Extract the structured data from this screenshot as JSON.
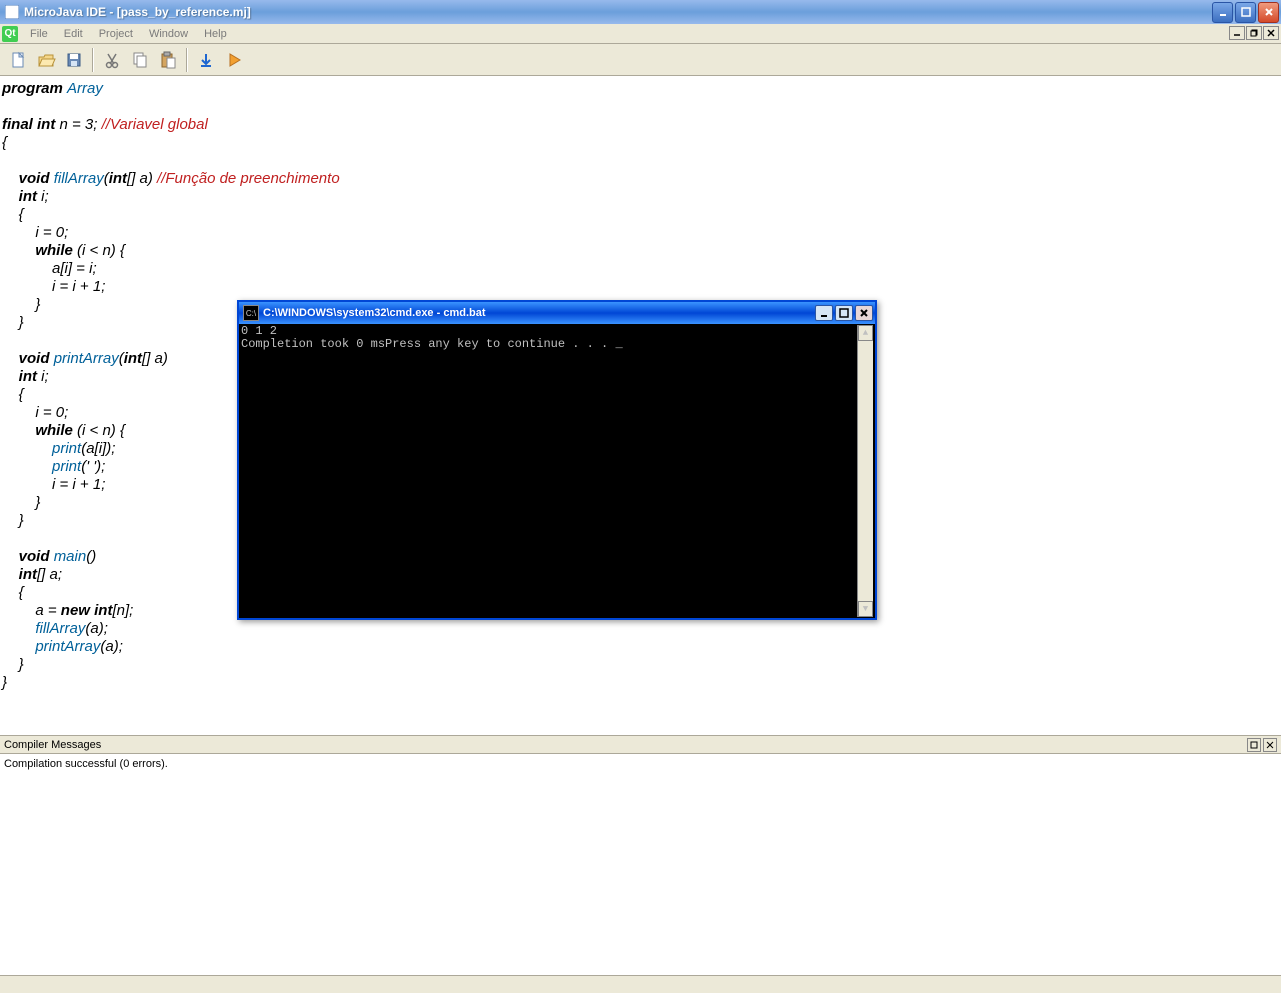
{
  "window": {
    "title": "MicroJava IDE - [pass_by_reference.mj]"
  },
  "menu": {
    "file": "File",
    "edit": "Edit",
    "project": "Project",
    "window": "Window",
    "help": "Help"
  },
  "compiler_panel": {
    "title": "Compiler Messages",
    "message": "Compilation successful (0 errors)."
  },
  "code": {
    "l1_kw": "program ",
    "l1_id": "Array",
    "l3a": "final int ",
    "l3b": "n = 3; ",
    "l3c": "//Variavel global",
    "l4": "{",
    "l6a": "    void ",
    "l6b": "fillArray",
    "l6c": "(",
    "l6d": "int",
    "l6e": "[] a) ",
    "l6f": "//Função de preenchimento",
    "l7a": "    int ",
    "l7b": "i;",
    "l8": "    {",
    "l9": "        i = 0;",
    "l10a": "        while ",
    "l10b": "(i < n) {",
    "l11": "            a[i] = i;",
    "l12": "            i = i + 1;",
    "l13": "        }",
    "l14": "    }",
    "l16a": "    void ",
    "l16b": "printArray",
    "l16c": "(",
    "l16d": "int",
    "l16e": "[] a)",
    "l17a": "    int ",
    "l17b": "i;",
    "l18": "    {",
    "l19": "        i = 0;",
    "l20a": "        while ",
    "l20b": "(i < n) {",
    "l21a": "            ",
    "l21b": "print",
    "l21c": "(a[i]);",
    "l22a": "            ",
    "l22b": "print",
    "l22c": "(' ');",
    "l23": "            i = i + 1;",
    "l24": "        }",
    "l25": "    }",
    "l27a": "    void ",
    "l27b": "main",
    "l27c": "()",
    "l28a": "    int",
    "l28b": "[] a;",
    "l29": "    {",
    "l30a": "        a = ",
    "l30b": "new int",
    "l30c": "[n];",
    "l31a": "        ",
    "l31b": "fillArray",
    "l31c": "(a);",
    "l32a": "        ",
    "l32b": "printArray",
    "l32c": "(a);",
    "l33": "    }",
    "l34": "}"
  },
  "cmd": {
    "title": "C:\\WINDOWS\\system32\\cmd.exe - cmd.bat",
    "line1": "0 1 2 ",
    "line2": "Completion took 0 msPress any key to continue . . . _"
  }
}
